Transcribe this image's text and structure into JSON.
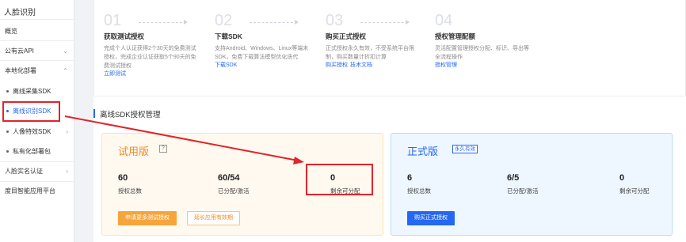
{
  "sidebar": {
    "title": "人脸识别",
    "items": [
      {
        "label": "概览"
      },
      {
        "label": "公有云API",
        "chevron": "⌄"
      },
      {
        "label": "本地化部署",
        "chevron": "⌃"
      },
      {
        "label": "离线采集SDK"
      },
      {
        "label": "离线识别SDK"
      },
      {
        "label": "人像特效SDK",
        "chevron": "›"
      },
      {
        "label": "私有化部署包"
      },
      {
        "label": "人脸实名认证",
        "chevron": "›"
      },
      {
        "label": "度目智能应用平台"
      }
    ]
  },
  "steps": [
    {
      "num": "01",
      "title": "获取测试授权",
      "desc": "完成个人认证获得2个30天的免费测试授权，完成企业认证获取5个90天的免费测试授权",
      "links": [
        "立即测试"
      ]
    },
    {
      "num": "02",
      "title": "下载SDK",
      "desc": "支持Android、Windows、Linux等端末SDK，免费下载算法模型优化迭代",
      "links": [
        "下载SDK"
      ]
    },
    {
      "num": "03",
      "title": "购买正式授权",
      "desc": "正式授权永久有效，不受系统平台限制，购买数量计折扣计算",
      "links": [
        "购买授权",
        "技术文档"
      ]
    },
    {
      "num": "04",
      "title": "授权管理配额",
      "desc": "灵活配置管理授权分配、标识、导出等全流程操作",
      "links": [
        "授权管理"
      ]
    }
  ],
  "section": {
    "title": "离线SDK授权管理"
  },
  "cards": {
    "trial": {
      "title": "试用版",
      "help": "?",
      "stats": [
        {
          "value": "60",
          "label": "授权总数"
        },
        {
          "value": "60/54",
          "label": "已分配/激活"
        },
        {
          "value": "0",
          "label": "剩余可分配"
        }
      ],
      "btn_primary": "申请更多测试授权",
      "btn_secondary": "延长应用有效期"
    },
    "formal": {
      "title": "正式版",
      "badge": "永久有效",
      "stats": [
        {
          "value": "6",
          "label": "授权总数"
        },
        {
          "value": "6/5",
          "label": "已分配/激活"
        },
        {
          "value": "0",
          "label": "剩余可分配"
        }
      ],
      "btn_primary": "购买正式授权"
    }
  },
  "colors": {
    "accent": "#2468f2",
    "trial": "#f08a24",
    "annotation": "#e0252b"
  }
}
